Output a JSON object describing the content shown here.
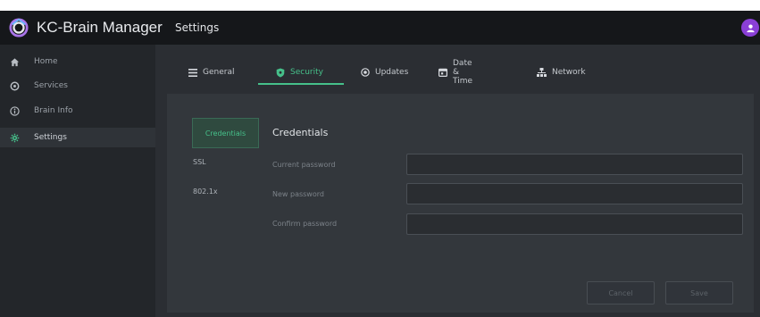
{
  "app": {
    "title": "KC-Brain Manager"
  },
  "header": {
    "page_title": "Settings"
  },
  "sidebar": {
    "items": [
      {
        "label": "Home",
        "icon": "home-icon"
      },
      {
        "label": "Services",
        "icon": "services-icon"
      },
      {
        "label": "Brain Info",
        "icon": "info-icon"
      },
      {
        "label": "Settings",
        "icon": "settings-icon",
        "active": true
      }
    ]
  },
  "tabs": [
    {
      "label": "General",
      "icon": "list-icon"
    },
    {
      "label": "Security",
      "icon": "shield-icon",
      "active": true
    },
    {
      "label": "Updates",
      "icon": "update-icon"
    },
    {
      "label": "Date & Time",
      "icon": "calendar-icon"
    },
    {
      "label": "Network",
      "icon": "network-icon"
    }
  ],
  "security": {
    "subnav": [
      {
        "label": "Credentials",
        "active": true
      },
      {
        "label": "SSL"
      },
      {
        "label": "802.1x"
      }
    ],
    "section_title": "Credentials",
    "fields": [
      {
        "label": "Current password",
        "value": ""
      },
      {
        "label": "New password",
        "value": ""
      },
      {
        "label": "Confirm password",
        "value": ""
      }
    ],
    "cancel_label": "Cancel",
    "save_label": "Save"
  },
  "colors": {
    "accent": "#46c08a",
    "avatar": "#8a3fd6",
    "topbar": "#15171a",
    "sidebar": "#23262a"
  }
}
